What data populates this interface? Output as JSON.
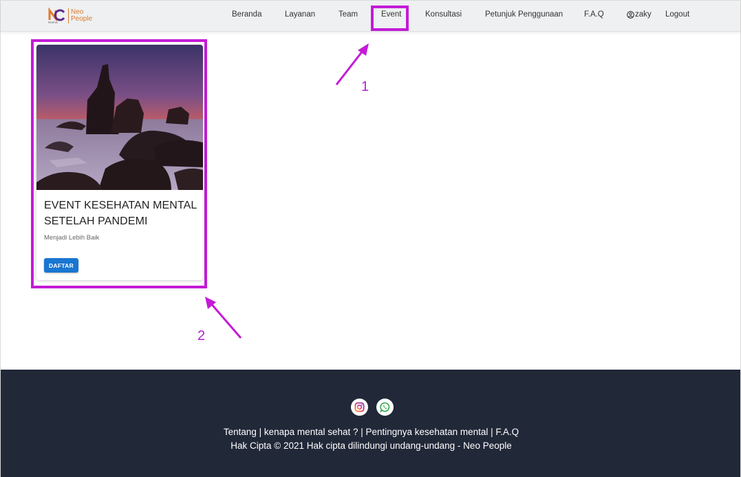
{
  "brand": {
    "name_line1": "Neo",
    "name_line2": "People",
    "mark": "NC",
    "mark_small": "PEOPLE"
  },
  "nav": {
    "items": [
      "Beranda",
      "Layanan",
      "Team",
      "Event",
      "Konsultasi",
      "Petunjuk Penggunaan",
      "F.A.Q"
    ],
    "user": "zaky",
    "logout": "Logout"
  },
  "annotations": {
    "one": "1",
    "two": "2"
  },
  "card": {
    "title": "EVENT KESEHATAN MENTAL SETELAH PANDEMI",
    "subtitle": "Menjadi Lebih Baik",
    "button": "DAFTAR",
    "image_icon": "coastal-rock-sunset-image"
  },
  "footer": {
    "social": [
      "instagram-icon",
      "whatsapp-icon"
    ],
    "links": "Tentang | kenapa mental sehat ? | Pentingnya kesehatan mental | F.A.Q",
    "copyright": "Hak Cipta © 2021 Hak cipta dilindungi undang-undang - Neo People"
  },
  "colors": {
    "accent": "#c31bd6",
    "button": "#1976d2",
    "footer_bg": "#212838",
    "nav_bg": "#eef0f2",
    "brand": "#e07b28"
  }
}
